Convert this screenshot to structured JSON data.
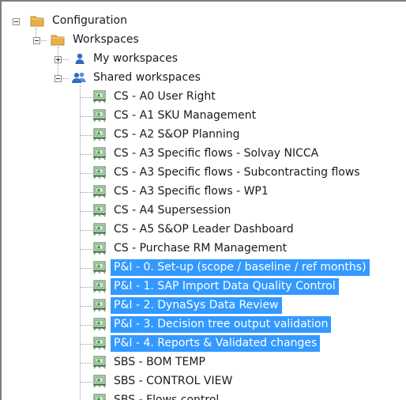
{
  "tree": {
    "root_label": "Configuration",
    "workspaces_label": "Workspaces",
    "my_workspaces_label": "My workspaces",
    "shared_workspaces_label": "Shared workspaces",
    "shared_items": [
      {
        "label": "CS - A0 User Right",
        "selected": false
      },
      {
        "label": "CS - A1 SKU Management",
        "selected": false
      },
      {
        "label": "CS - A2 S&OP Planning",
        "selected": false
      },
      {
        "label": "CS - A3 Specific flows - Solvay NICCA",
        "selected": false
      },
      {
        "label": "CS - A3 Specific flows - Subcontracting flows",
        "selected": false
      },
      {
        "label": "CS - A3 Specific flows - WP1",
        "selected": false
      },
      {
        "label": "CS - A4 Supersession",
        "selected": false
      },
      {
        "label": "CS - A5 S&OP Leader Dashboard",
        "selected": false
      },
      {
        "label": "CS - Purchase RM Management",
        "selected": false
      },
      {
        "label": "P&I - 0. Set-up (scope / baseline / ref months)",
        "selected": true
      },
      {
        "label": "P&I - 1. SAP Import Data Quality Control",
        "selected": true
      },
      {
        "label": "P&I - 2. DynaSys Data Review",
        "selected": true
      },
      {
        "label": "P&I - 3. Decision tree output validation",
        "selected": true
      },
      {
        "label": "P&I - 4. Reports & Validated changes",
        "selected": true
      },
      {
        "label": "SBS - BOM TEMP",
        "selected": false
      },
      {
        "label": "SBS - CONTROL VIEW",
        "selected": false
      },
      {
        "label": "SBS - Flows control",
        "selected": false
      }
    ]
  },
  "colors": {
    "selection": "#3399ff",
    "folder": "#e8b04a",
    "user": "#2f6fbf",
    "workspace_icon": "#2e7d32"
  },
  "icons": {
    "root": "folder-icon",
    "workspaces": "folder-icon",
    "my_workspaces": "user-icon",
    "shared_workspaces": "users-icon",
    "workspace_item": "workspace-icon"
  }
}
